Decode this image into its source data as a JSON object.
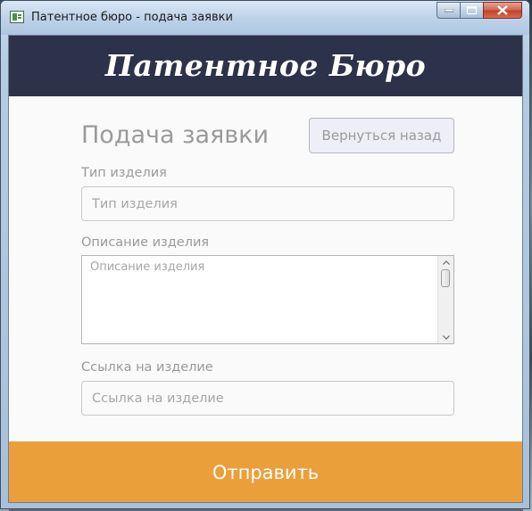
{
  "window": {
    "title": "Патентное бюро - подача заявки"
  },
  "header": {
    "brand": "Патентное Бюро"
  },
  "form": {
    "title": "Подача заявки",
    "back_label": "Вернуться назад",
    "type_label": "Тип изделия",
    "type_placeholder": "Тип изделия",
    "type_value": "",
    "description_label": "Описание изделия",
    "description_placeholder": "Описание изделия",
    "description_value": "",
    "link_label": "Ссылка на изделие",
    "link_placeholder": "Ссылка на изделие",
    "link_value": "",
    "submit_label": "Отправить"
  },
  "colors": {
    "header_bg": "#2c3249",
    "submit_bg": "#eb9f3b",
    "text_muted": "#9a9a9a"
  },
  "icons": {
    "app": "app-icon",
    "minimize": "minimize-icon",
    "maximize": "maximize-icon",
    "close": "close-icon",
    "scroll_up": "chevron-up-icon",
    "scroll_down": "chevron-down-icon"
  }
}
